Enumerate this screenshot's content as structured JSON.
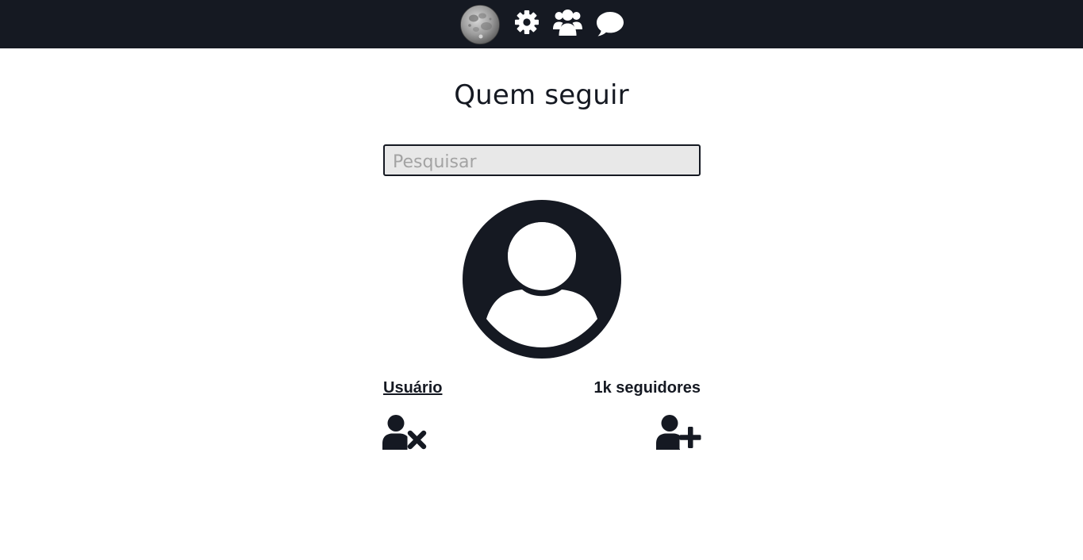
{
  "colors": {
    "navbar_bg": "#151922",
    "icon": "#ffffff",
    "text": "#151922",
    "input_bg": "#e8e8e8",
    "placeholder": "#a3a3a3"
  },
  "navbar": {
    "items": [
      {
        "icon": "moon-logo-icon"
      },
      {
        "icon": "gear-icon"
      },
      {
        "icon": "users-icon"
      },
      {
        "icon": "chat-bubble-icon"
      }
    ]
  },
  "main": {
    "title": "Quem seguir",
    "search": {
      "placeholder": "Pesquisar",
      "value": ""
    },
    "suggestion": {
      "avatar_icon": "user-circle-icon",
      "username": "Usuário",
      "followers": "1k seguidores",
      "remove_icon": "user-remove-icon",
      "follow_icon": "user-add-icon"
    }
  }
}
